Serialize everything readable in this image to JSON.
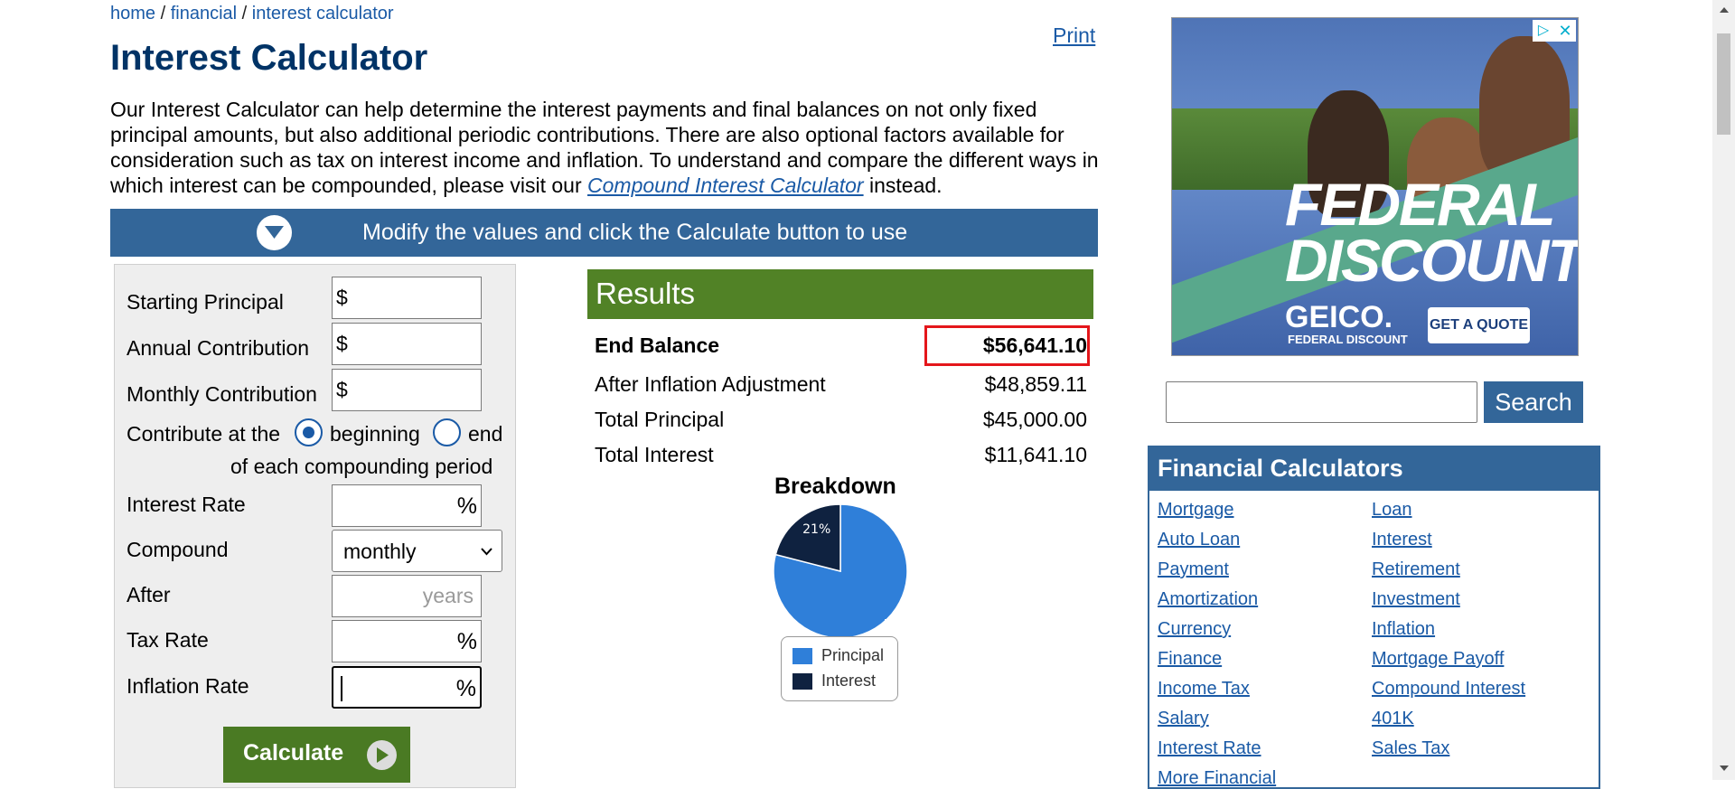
{
  "breadcrumb": {
    "home": "home",
    "sep": "/",
    "financial": "financial",
    "current": "interest calculator"
  },
  "print_label": "Print",
  "title": "Interest Calculator",
  "intro": {
    "text_before_link": "Our Interest Calculator can help determine the interest payments and final balances on not only fixed principal amounts, but also additional periodic contributions. There are also optional factors available for consideration such as tax on interest income and inflation. To understand and compare the different ways in which interest can be compounded, please visit our ",
    "link": "Compound Interest Calculator",
    "text_after_link": " instead."
  },
  "banner": {
    "text": "Modify the values and click the Calculate button to use",
    "icon": "chevron-down-circle-icon"
  },
  "form": {
    "starting_principal": {
      "label": "Starting Principal",
      "prefix": "$",
      "value": ""
    },
    "annual_contribution": {
      "label": "Annual Contribution",
      "prefix": "$",
      "value": ""
    },
    "monthly_contribution": {
      "label": "Monthly Contribution",
      "prefix": "$",
      "value": ""
    },
    "contribute_at": {
      "label": "Contribute at the",
      "option_beginning": "beginning",
      "option_end": "end",
      "selected": "beginning",
      "trailing": "of each compounding period"
    },
    "interest_rate": {
      "label": "Interest Rate",
      "suffix": "%",
      "value": ""
    },
    "compound": {
      "label": "Compound",
      "value": "monthly"
    },
    "after": {
      "label": "After",
      "placeholder": "years"
    },
    "tax_rate": {
      "label": "Tax Rate",
      "suffix": "%",
      "value": ""
    },
    "inflation_rate": {
      "label": "Inflation Rate",
      "suffix": "%",
      "value": ""
    },
    "calculate_label": "Calculate"
  },
  "results": {
    "heading": "Results",
    "end_balance": {
      "label": "End Balance",
      "value": "$56,641.10"
    },
    "after_inflation": {
      "label": "After Inflation Adjustment",
      "value": "$48,859.11"
    },
    "total_principal": {
      "label": "Total Principal",
      "value": "$45,000.00"
    },
    "total_interest": {
      "label": "Total Interest",
      "value": "$11,641.10"
    }
  },
  "chart_data": {
    "type": "pie",
    "title": "Breakdown",
    "categories": [
      "Principal",
      "Interest"
    ],
    "values": [
      79,
      21
    ],
    "value_labels": [
      "79%",
      "21%"
    ],
    "colors": [
      "#2f7fd9",
      "#0f2240"
    ],
    "legend_placement": "bottom"
  },
  "ad": {
    "headline_1": "FEDERAL",
    "headline_2": "DISCOUNT",
    "brand": "GEICO.",
    "brand_sub": "FEDERAL DISCOUNT",
    "cta": "GET A QUOTE",
    "info_icon": "ad-info-icon",
    "close_icon": "close-icon"
  },
  "search": {
    "button_label": "Search",
    "value": ""
  },
  "financial_calculators": {
    "heading": "Financial Calculators",
    "left": [
      "Mortgage",
      "Auto Loan",
      "Payment",
      "Amortization",
      "Currency",
      "Finance",
      "Income Tax",
      "Salary",
      "Interest Rate",
      "More Financial"
    ],
    "right": [
      "Loan",
      "Interest",
      "Retirement",
      "Investment",
      "Inflation",
      "Mortgage Payoff",
      "Compound Interest",
      "401K",
      "Sales Tax"
    ]
  },
  "colors": {
    "primary_blue": "#336699",
    "results_green": "#518226",
    "calculate_green": "#4a7a23",
    "highlight_red": "#e4161b",
    "link_blue": "#1a5aa6"
  }
}
